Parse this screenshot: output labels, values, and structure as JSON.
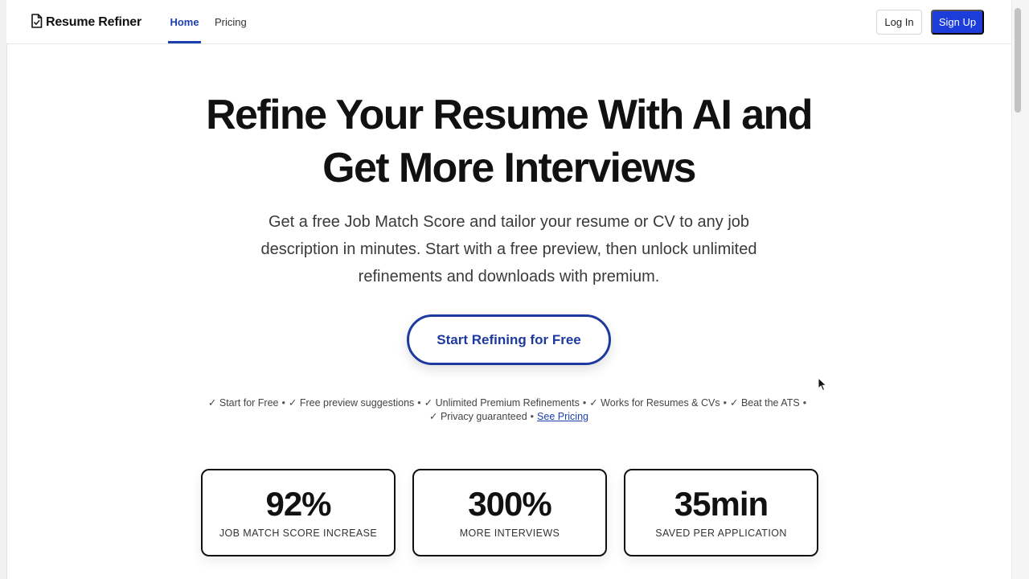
{
  "app": {
    "logo_text": "Resume Refiner"
  },
  "nav": {
    "home_label": "Home",
    "pricing_label": "Pricing",
    "login_label": "Log In",
    "signup_label": "Sign Up"
  },
  "hero": {
    "title_line1": "Refine Your Resume With AI and",
    "title_line2": "Get More Interviews",
    "subtitle_line1": "Get a free Job Match Score and tailor your resume or CV to any job",
    "subtitle_line2": "description in minutes. Start with a free preview, then unlock unlimited",
    "subtitle_line3": "refinements and downloads with premium.",
    "cta_label": "Start Refining for Free"
  },
  "features": {
    "items": [
      "✓ Start for Free",
      "✓ Free preview suggestions",
      "✓ Unlimited Premium Refinements",
      "✓ Works for Resumes & CVs",
      "✓ Beat the ATS",
      "✓ Privacy guaranteed"
    ],
    "separator": "•",
    "link_label": "See Pricing"
  },
  "stats": [
    {
      "value": "92%",
      "label": "JOB MATCH SCORE INCREASE"
    },
    {
      "value": "300%",
      "label": "MORE INTERVIEWS"
    },
    {
      "value": "35min",
      "label": "SAVED PER APPLICATION"
    }
  ],
  "colors": {
    "brand_blue": "#1d3ddb",
    "nav_active": "#1e40af",
    "cta_border": "#1e3a9e"
  },
  "icons": {
    "logo": "document-check-icon",
    "cursor": "mouse-pointer-icon"
  }
}
